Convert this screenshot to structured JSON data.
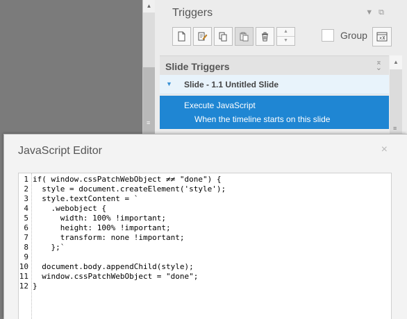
{
  "triggers_panel": {
    "title": "Triggers",
    "group_label": "Group",
    "section_title": "Slide Triggers",
    "slide_label": "Slide - 1.1 Untitled Slide",
    "trigger_action": "Execute JavaScript",
    "trigger_condition": "When the timeline starts on this slide",
    "toolbar_icons": [
      "new-trigger-icon",
      "edit-trigger-icon",
      "copy-icon",
      "paste-icon",
      "delete-icon",
      "move-up-down-icon"
    ]
  },
  "dialog": {
    "title": "JavaScript Editor",
    "close_glyph": "×",
    "lines": [
      {
        "num": "1",
        "text": "if( window.cssPatchWebObject ≠≠ \"done\") {"
      },
      {
        "num": "2",
        "text": "  style = document.createElement('style');"
      },
      {
        "num": "3",
        "text": "  style.textContent = `"
      },
      {
        "num": "4",
        "text": "    .webobject {"
      },
      {
        "num": "5",
        "text": "      width: 100% !important;"
      },
      {
        "num": "6",
        "text": "      height: 100% !important;"
      },
      {
        "num": "7",
        "text": "      transform: none !important;"
      },
      {
        "num": "8",
        "text": "    };`"
      },
      {
        "num": "9",
        "text": ""
      },
      {
        "num": "10",
        "text": "  document.body.appendChild(style);"
      },
      {
        "num": "11",
        "text": "  window.cssPatchWebObject = \"done\";"
      },
      {
        "num": "12",
        "text": "}"
      }
    ]
  },
  "colors": {
    "selected_row": "#1f86d3",
    "slide_row": "#e8f3fb",
    "stage": "#7b7b7b"
  }
}
